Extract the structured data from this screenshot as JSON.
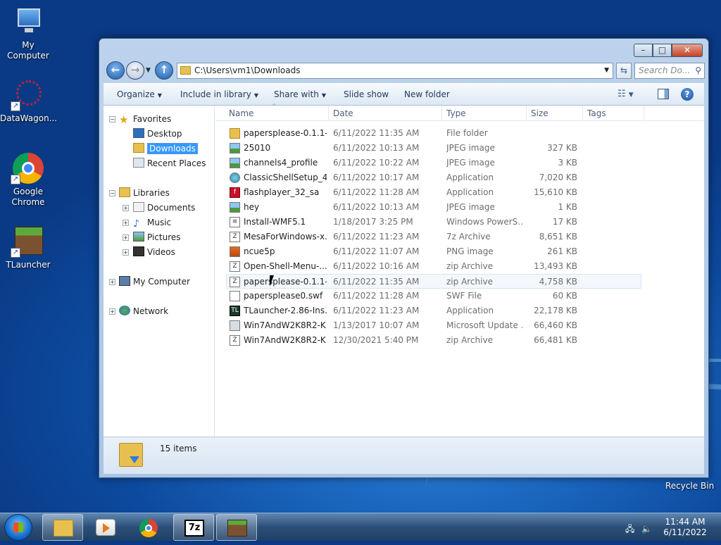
{
  "desktop": {
    "icons": [
      {
        "label": "My Computer"
      },
      {
        "label": "DataWagon..."
      },
      {
        "label": "Google Chrome"
      },
      {
        "label": "TLauncher"
      }
    ],
    "recycle_bin": "Recycle Bin"
  },
  "window": {
    "address": "C:\\Users\\vm1\\Downloads",
    "search_placeholder": "Search Do...",
    "toolbar": {
      "organize": "Organize",
      "include_in_library": "Include in library",
      "share_with": "Share with",
      "slide_show": "Slide show",
      "new_folder": "New folder"
    },
    "nav": {
      "favorites": "Favorites",
      "desktop": "Desktop",
      "downloads": "Downloads",
      "recent_places": "Recent Places",
      "libraries": "Libraries",
      "documents": "Documents",
      "music": "Music",
      "pictures": "Pictures",
      "videos": "Videos",
      "my_computer": "My Computer",
      "network": "Network"
    },
    "columns": {
      "name": "Name",
      "date": "Date",
      "type": "Type",
      "size": "Size",
      "tags": "Tags"
    },
    "files": [
      {
        "name": "papersplease-0.1.1-...",
        "date": "6/11/2022 11:35 AM",
        "type": "File folder",
        "size": "",
        "icon": "folder-icon"
      },
      {
        "name": "25010",
        "date": "6/11/2022 10:13 AM",
        "type": "JPEG image",
        "size": "327 KB",
        "icon": "image-icon"
      },
      {
        "name": "channels4_profile",
        "date": "6/11/2022 10:22 AM",
        "type": "JPEG image",
        "size": "3 KB",
        "icon": "image-icon"
      },
      {
        "name": "ClassicShellSetup_4...",
        "date": "6/11/2022 10:17 AM",
        "type": "Application",
        "size": "7,020 KB",
        "icon": "shell-icon"
      },
      {
        "name": "flashplayer_32_sa",
        "date": "6/11/2022 11:28 AM",
        "type": "Application",
        "size": "15,610 KB",
        "icon": "flash-icon"
      },
      {
        "name": "hey",
        "date": "6/11/2022 10:13 AM",
        "type": "JPEG image",
        "size": "1 KB",
        "icon": "image-icon"
      },
      {
        "name": "Install-WMF5.1",
        "date": "1/18/2017 3:25 PM",
        "type": "Windows PowerS...",
        "size": "17 KB",
        "icon": "powershell-icon"
      },
      {
        "name": "MesaForWindows-x...",
        "date": "6/11/2022 11:23 AM",
        "type": "7z Archive",
        "size": "8,651 KB",
        "icon": "archive-icon"
      },
      {
        "name": "ncue5p",
        "date": "6/11/2022 11:07 AM",
        "type": "PNG image",
        "size": "261 KB",
        "icon": "png-icon"
      },
      {
        "name": "Open-Shell-Menu-...",
        "date": "6/11/2022 10:16 AM",
        "type": "zip Archive",
        "size": "13,493 KB",
        "icon": "archive-icon"
      },
      {
        "name": "papersplease-0.1.1-...",
        "date": "6/11/2022 11:35 AM",
        "type": "zip Archive",
        "size": "4,758 KB",
        "icon": "archive-icon"
      },
      {
        "name": "papersplease0.swf",
        "date": "6/11/2022 11:28 AM",
        "type": "SWF File",
        "size": "60 KB",
        "icon": "file-icon"
      },
      {
        "name": "TLauncher-2.86-Ins...",
        "date": "6/11/2022 11:23 AM",
        "type": "Application",
        "size": "22,178 KB",
        "icon": "tlauncher-icon"
      },
      {
        "name": "Win7AndW2K8R2-K...",
        "date": "1/13/2017 10:07 AM",
        "type": "Microsoft Update ...",
        "size": "66,460 KB",
        "icon": "update-icon"
      },
      {
        "name": "Win7AndW2K8R2-K...",
        "date": "12/30/2021 5:40 PM",
        "type": "zip Archive",
        "size": "66,481 KB",
        "icon": "archive-icon"
      }
    ],
    "status": "15 items"
  },
  "taskbar": {
    "time": "11:44 AM",
    "date": "6/11/2022"
  }
}
